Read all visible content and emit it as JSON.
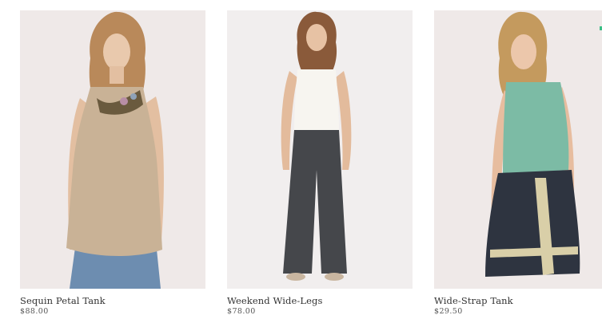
{
  "products": [
    {
      "name": "Sequin Petal Tank",
      "price": "$88.00",
      "image_icon": "product-photo-sequin-petal-tank",
      "top_color": "#c9b296",
      "bottom_color": "#6d8db0",
      "background": "#efe9e8"
    },
    {
      "name": "Weekend Wide-Legs",
      "price": "$78.00",
      "image_icon": "product-photo-weekend-wide-legs",
      "top_color": "#f5f3ee",
      "bottom_color": "#45474b",
      "background": "#f1eeee"
    },
    {
      "name": "Wide-Strap Tank",
      "price": "$29.50",
      "image_icon": "product-photo-wide-strap-tank",
      "top_color": "#7cbba5",
      "bottom_color": "#2e3440",
      "background": "#efe9e8"
    }
  ]
}
